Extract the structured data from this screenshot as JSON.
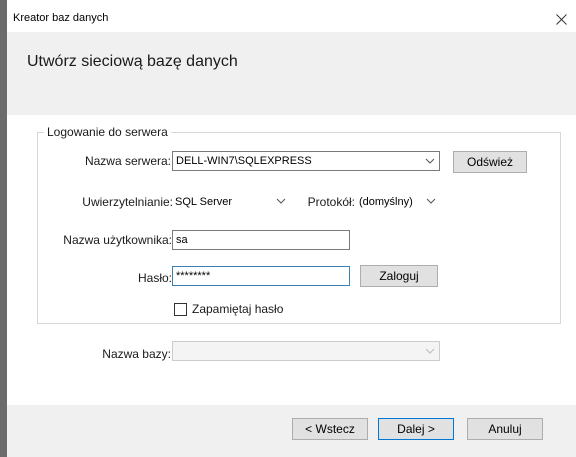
{
  "window": {
    "title": "Kreator baz danych",
    "close_glyph": "✕"
  },
  "header": {
    "title": "Utwórz sieciową bazę danych"
  },
  "server_group": {
    "legend": "Logowanie do serwera",
    "server_label": "Nazwa serwera:",
    "server_value": "DELL-WIN7\\SQLEXPRESS",
    "refresh_label": "Odśwież",
    "auth_label": "Uwierzytelnianie:",
    "auth_value": "SQL Server",
    "protocol_label": "Protokół:",
    "protocol_value": "(domyślny)",
    "username_label": "Nazwa użytkownika:",
    "username_value": "sa",
    "password_label": "Hasło:",
    "password_value": "********",
    "login_label": "Zaloguj",
    "remember_label": "Zapamiętaj hasło",
    "remember_checked": false
  },
  "database": {
    "label": "Nazwa bazy:",
    "value": ""
  },
  "footer": {
    "back_label": "< Wstecz",
    "next_label": "Dalej >",
    "cancel_label": "Anuluj"
  },
  "icons": {
    "close": "close-icon",
    "dropdown": "chevron-down-icon"
  },
  "colors": {
    "header_band": "#f0f0f0",
    "focus_border": "#3c7fb1",
    "button_face": "#e1e1e1"
  }
}
